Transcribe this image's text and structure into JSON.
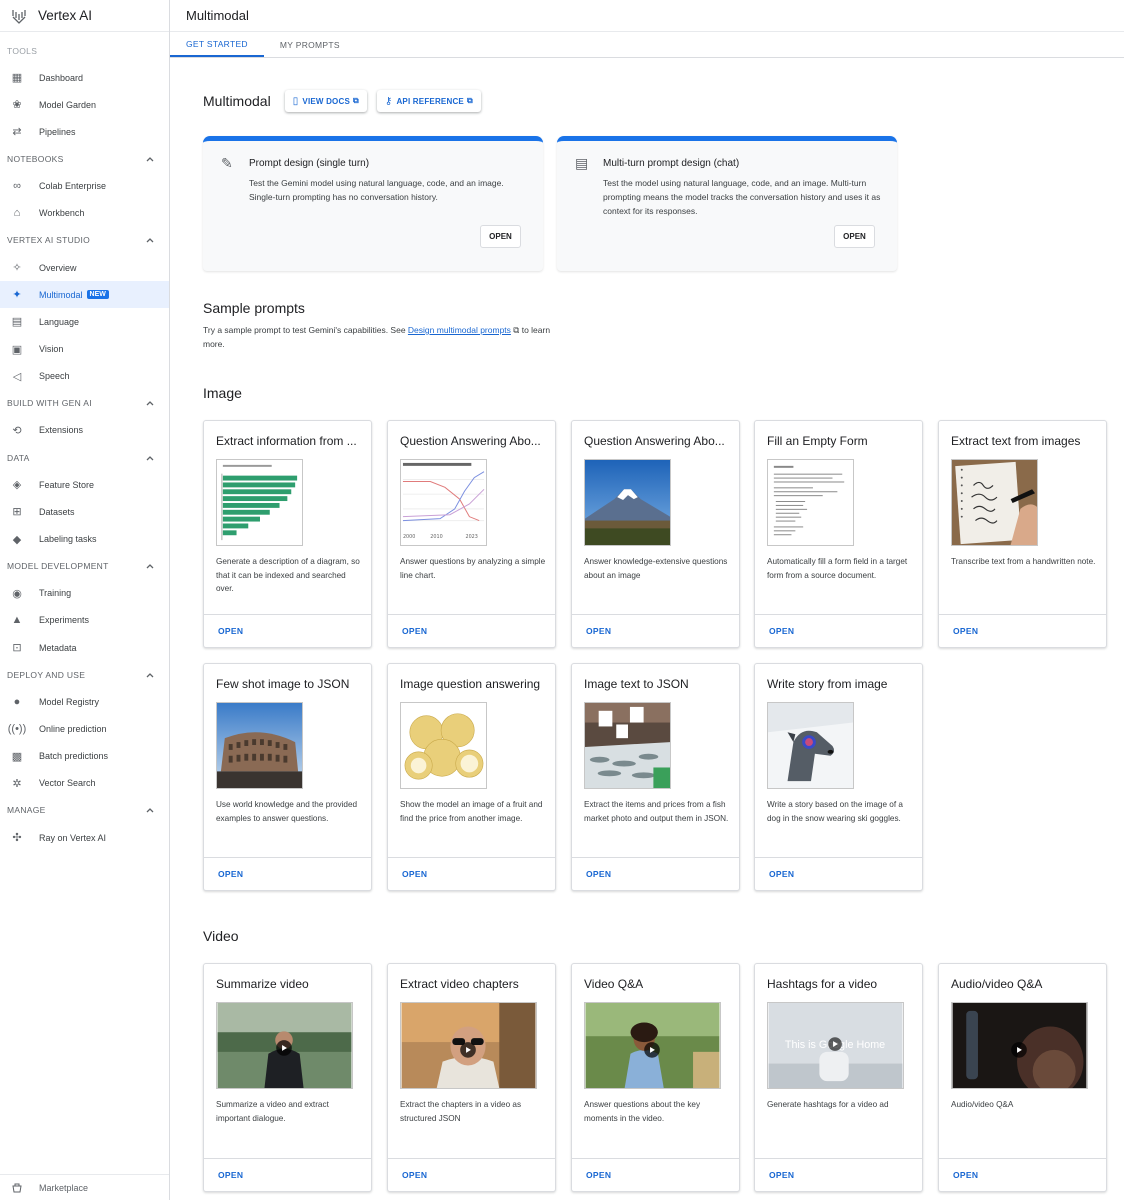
{
  "app": {
    "title": "Vertex AI"
  },
  "header": {
    "title": "Multimodal"
  },
  "tabs": [
    {
      "label": "GET STARTED"
    },
    {
      "label": "MY PROMPTS"
    }
  ],
  "sidebar": {
    "tools_label": "TOOLS",
    "tools": [
      {
        "label": "Dashboard"
      },
      {
        "label": "Model Garden"
      },
      {
        "label": "Pipelines"
      }
    ],
    "sections": [
      {
        "label": "NOTEBOOKS",
        "items": [
          {
            "label": "Colab Enterprise"
          },
          {
            "label": "Workbench"
          }
        ]
      },
      {
        "label": "VERTEX AI STUDIO",
        "items": [
          {
            "label": "Overview"
          },
          {
            "label": "Multimodal",
            "badge": "NEW"
          },
          {
            "label": "Language"
          },
          {
            "label": "Vision"
          },
          {
            "label": "Speech"
          }
        ]
      },
      {
        "label": "BUILD WITH GEN AI",
        "items": [
          {
            "label": "Extensions"
          }
        ]
      },
      {
        "label": "DATA",
        "items": [
          {
            "label": "Feature Store"
          },
          {
            "label": "Datasets"
          },
          {
            "label": "Labeling tasks"
          }
        ]
      },
      {
        "label": "MODEL DEVELOPMENT",
        "items": [
          {
            "label": "Training"
          },
          {
            "label": "Experiments"
          },
          {
            "label": "Metadata"
          }
        ]
      },
      {
        "label": "DEPLOY AND USE",
        "items": [
          {
            "label": "Model Registry"
          },
          {
            "label": "Online prediction"
          },
          {
            "label": "Batch predictions"
          },
          {
            "label": "Vector Search"
          }
        ]
      },
      {
        "label": "MANAGE",
        "items": [
          {
            "label": "Ray on Vertex AI"
          }
        ]
      }
    ],
    "footer": {
      "label": "Marketplace"
    }
  },
  "main": {
    "title": "Multimodal",
    "view_docs": "VIEW DOCS",
    "api_reference": "API REFERENCE",
    "big_cards": [
      {
        "title": "Prompt design (single turn)",
        "desc": "Test the Gemini model using natural language, code, and an image. Single-turn prompting has no conversation history.",
        "button": "OPEN"
      },
      {
        "title": "Multi-turn prompt design (chat)",
        "desc": "Test the model using natural language, code, and an image. Multi-turn prompting means the model tracks the conversation history and uses it as context for its responses.",
        "button": "OPEN"
      }
    ],
    "sample": {
      "title": "Sample prompts",
      "desc_before": "Try a sample prompt to test Gemini's capabilities. See ",
      "link": "Design multimodal prompts",
      "desc_after": " to learn more."
    },
    "image_section": {
      "title": "Image",
      "cards": [
        {
          "title": "Extract information from ...",
          "desc": "Generate a description of a diagram, so that it can be indexed and searched over.",
          "open": "OPEN"
        },
        {
          "title": "Question Answering Abo...",
          "desc": "Answer questions by analyzing a simple line chart.",
          "open": "OPEN"
        },
        {
          "title": "Question Answering Abo...",
          "desc": "Answer knowledge-extensive questions about an image",
          "open": "OPEN"
        },
        {
          "title": "Fill an Empty Form",
          "desc": "Automatically fill a form field in a target form from a source document.",
          "open": "OPEN"
        },
        {
          "title": "Extract text from images",
          "desc": "Transcribe text from a handwritten note.",
          "open": "OPEN"
        },
        {
          "title": "Few shot image to JSON",
          "desc": "Use world knowledge and the provided examples to answer questions.",
          "open": "OPEN"
        },
        {
          "title": "Image question answering",
          "desc": "Show the model an image of a fruit and find the price from another image.",
          "open": "OPEN"
        },
        {
          "title": "Image text to JSON",
          "desc": "Extract the items and prices from a fish market photo and output them in JSON.",
          "open": "OPEN"
        },
        {
          "title": "Write story from image",
          "desc": "Write a story based on the image of a dog in the snow wearing ski goggles.",
          "open": "OPEN"
        }
      ]
    },
    "video_section": {
      "title": "Video",
      "cards": [
        {
          "title": "Summarize video",
          "desc": "Summarize a video and extract important dialogue.",
          "open": "OPEN"
        },
        {
          "title": "Extract video chapters",
          "desc": "Extract the chapters in a video as structured JSON",
          "open": "OPEN"
        },
        {
          "title": "Video Q&A",
          "desc": "Answer questions about the key moments in the video.",
          "open": "OPEN"
        },
        {
          "title": "Hashtags for a video",
          "desc": "Generate hashtags for a video ad",
          "open": "OPEN",
          "thumb_text": "This is Google Home"
        },
        {
          "title": "Audio/video Q&A",
          "desc": "Audio/video Q&A",
          "open": "OPEN"
        }
      ]
    }
  },
  "colors": {
    "accent": "#1a73e8",
    "link": "#1967d2",
    "active_bg": "#e8f0fe"
  }
}
